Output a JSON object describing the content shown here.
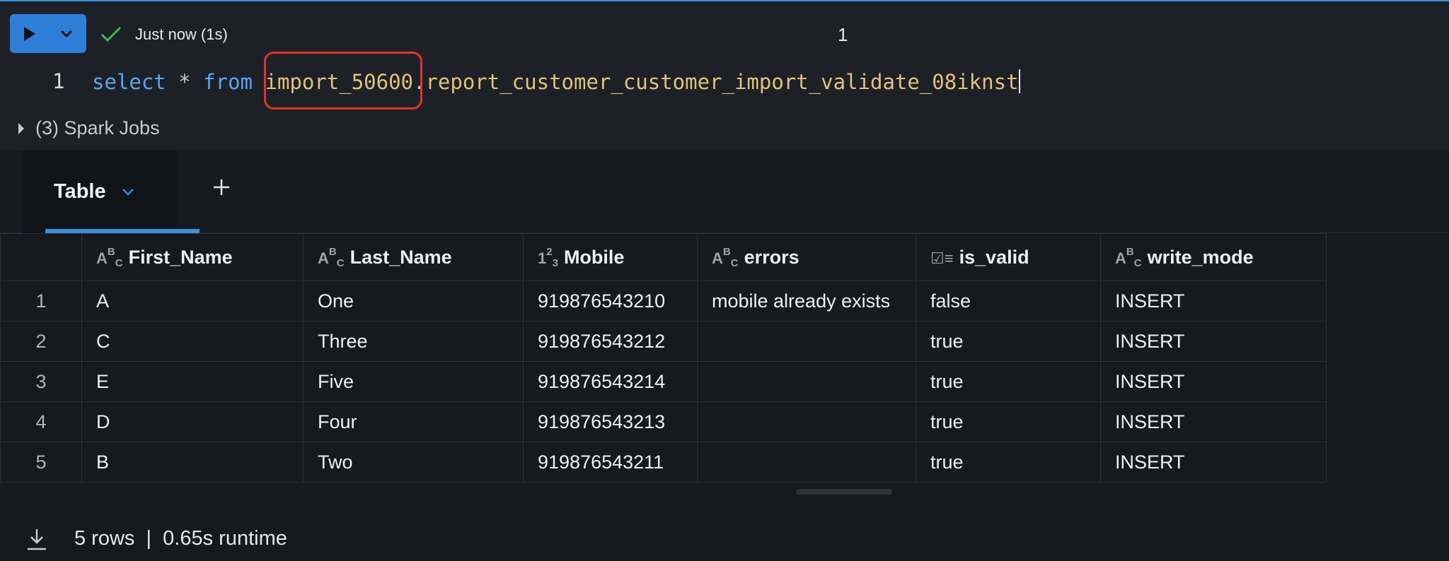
{
  "status": {
    "text": "Just now (1s)",
    "cell_number": "1"
  },
  "editor": {
    "line_number": "1",
    "tokens": {
      "select": "select",
      "star": "*",
      "from": "from",
      "schema": "import_50600",
      "dot": ".",
      "table": "report_customer_customer_import_validate_08iknst"
    }
  },
  "spark": {
    "label": "(3) Spark Jobs"
  },
  "tabs": {
    "active_label": "Table"
  },
  "table": {
    "columns": [
      {
        "icon": "abc",
        "label": "First_Name"
      },
      {
        "icon": "123",
        "label": "Last_Name"
      },
      {
        "icon": "123",
        "label": "Mobile"
      },
      {
        "icon": "abc",
        "label": "errors"
      },
      {
        "icon": "checklist",
        "label": "is_valid"
      },
      {
        "icon": "abc",
        "label": "write_mode"
      }
    ],
    "rows": [
      [
        "1",
        "A",
        "One",
        "919876543210",
        "mobile already exists",
        "false",
        "INSERT"
      ],
      [
        "2",
        "C",
        "Three",
        "919876543212",
        "",
        "true",
        "INSERT"
      ],
      [
        "3",
        "E",
        "Five",
        "919876543214",
        "",
        "true",
        "INSERT"
      ],
      [
        "4",
        "D",
        "Four",
        "919876543213",
        "",
        "true",
        "INSERT"
      ],
      [
        "5",
        "B",
        "Two",
        "919876543211",
        "",
        "true",
        "INSERT"
      ]
    ]
  },
  "footer": {
    "summary": "5 rows  |  0.65s runtime"
  }
}
